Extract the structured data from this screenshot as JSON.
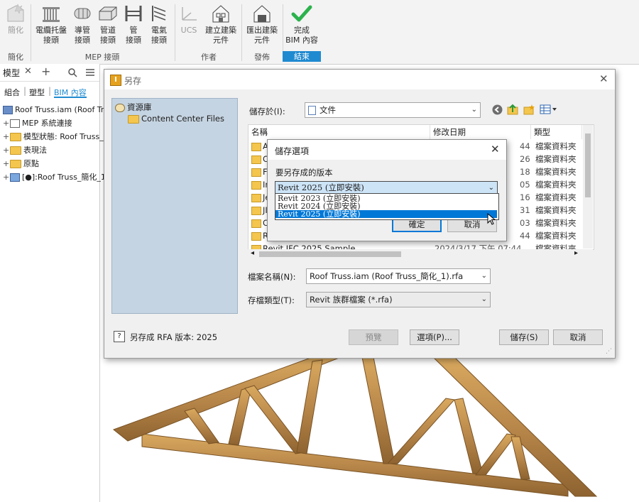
{
  "ribbon": {
    "buttons": [
      {
        "id": "simplify",
        "label": "簡化",
        "disabled": true
      },
      {
        "id": "cable-tray",
        "label": "電纜托盤\n接頭"
      },
      {
        "id": "conduit",
        "label": "導管\n接頭"
      },
      {
        "id": "duct",
        "label": "管道\n接頭"
      },
      {
        "id": "pipe",
        "label": "管\n接頭"
      },
      {
        "id": "electrical",
        "label": "電氣\n接頭"
      },
      {
        "id": "ucs",
        "label": "UCS",
        "disabled": true
      },
      {
        "id": "author-component",
        "label": "建立建築\n元件"
      },
      {
        "id": "export-component",
        "label": "匯出建築\n元件"
      },
      {
        "id": "finish-bim",
        "label": "完成\nBIM 內容"
      }
    ],
    "groups": [
      "簡化",
      "MEP 接頭",
      "作者",
      "發佈",
      "結束"
    ]
  },
  "panel": {
    "title": "模型",
    "tabs": [
      "組合",
      "塑型",
      "BIM 內容"
    ],
    "tree": [
      "Roof Truss.iam (Roof Truss",
      "MEP 系統連接",
      "模型狀態: Roof Truss_",
      "表現法",
      "原點",
      "[●]:Roof Truss_簡化_1"
    ]
  },
  "dialog": {
    "title": "另存",
    "places": {
      "root": "資源庫",
      "child": "Content Center Files"
    },
    "save_in_label": "儲存於(I):",
    "save_in_value": "文件",
    "columns": [
      "名稱",
      "修改日期",
      "類型"
    ],
    "rows": [
      {
        "name": "A",
        "date": "44",
        "type": "檔案資料夾"
      },
      {
        "name": "C",
        "date": "26",
        "type": "檔案資料夾"
      },
      {
        "name": "F",
        "date": "18",
        "type": "檔案資料夾"
      },
      {
        "name": "In",
        "date": "05",
        "type": "檔案資料夾"
      },
      {
        "name": "Je",
        "date": "16",
        "type": "檔案資料夾"
      },
      {
        "name": "JI",
        "date": "31",
        "type": "檔案資料夾"
      },
      {
        "name": "C",
        "date": "03",
        "type": "檔案資料夾"
      },
      {
        "name": "R",
        "date": "44",
        "type": "檔案資料夾"
      },
      {
        "name": "Revit IFC 2025 Sample",
        "date": "2024/3/17 下午 07:44",
        "type": "檔案資料夾"
      }
    ],
    "filename_label": "檔案名稱(N):",
    "filename_value": "Roof Truss.iam (Roof Truss_簡化_1).rfa",
    "filetype_label": "存檔類型(T):",
    "filetype_value": "Revit 族群檔案 (*.rfa)",
    "info_text": "另存成 RFA 版本: 2025",
    "preview_btn": "預覽",
    "options_btn": "選項(P)...",
    "save_btn": "儲存(S)",
    "cancel_btn": "取消"
  },
  "options_dialog": {
    "title": "儲存選項",
    "version_label": "要另存成的版本",
    "selected": "Revit 2025 (立即安裝)",
    "options": [
      "Revit 2023 (立即安裝)",
      "Revit 2024 (立即安裝)",
      "Revit 2025 (立即安裝)"
    ],
    "ok_btn": "確定",
    "cancel_btn": "取消"
  },
  "colors": {
    "accent": "#1f8ad0",
    "selection": "#0078d7",
    "check": "#2bb24c",
    "wood": "#b88a4a"
  }
}
